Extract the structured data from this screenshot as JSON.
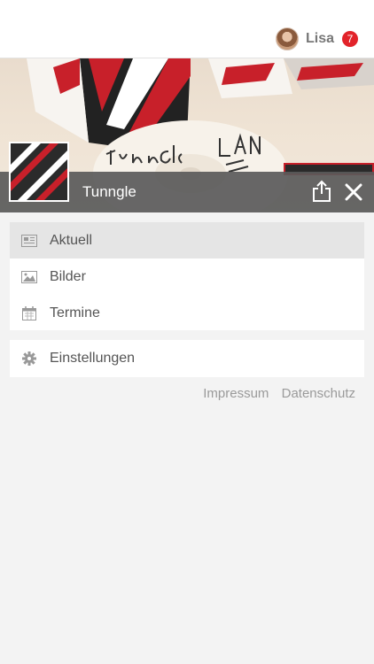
{
  "header": {
    "username": "Lisa",
    "notification_count": "7"
  },
  "banner": {
    "title": "Tunngle"
  },
  "menu": {
    "main_items": [
      {
        "label": "Aktuell",
        "icon": "newspaper-icon",
        "active": true
      },
      {
        "label": "Bilder",
        "icon": "image-icon",
        "active": false
      },
      {
        "label": "Termine",
        "icon": "calendar-icon",
        "active": false
      }
    ],
    "settings_label": "Einstellungen"
  },
  "footer": {
    "impressum": "Impressum",
    "datenschutz": "Datenschutz"
  },
  "colors": {
    "badge": "#e2232a",
    "title_bar": "#5a5a5a",
    "active_item": "#e5e5e5"
  }
}
